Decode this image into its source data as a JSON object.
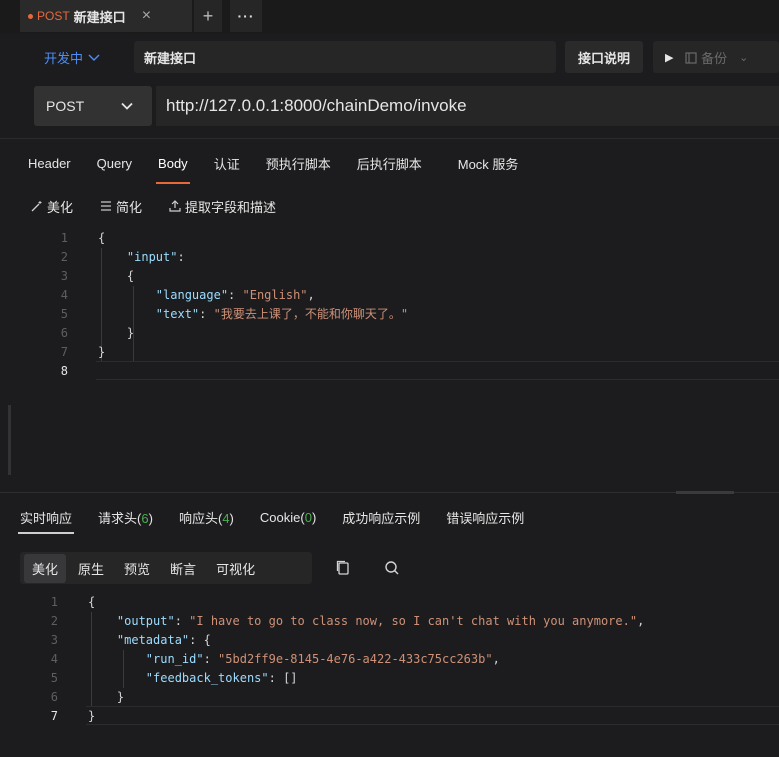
{
  "tab": {
    "method": "POST",
    "title": "新建接口",
    "close": "×",
    "add": "+",
    "more": "···"
  },
  "info": {
    "status": "开发中",
    "name": "新建接口",
    "doc_button": "接口说明",
    "backup_label": "备份"
  },
  "request": {
    "method": "POST",
    "url": "http://127.0.0.1:8000/chainDemo/invoke"
  },
  "req_tabs": [
    "Header",
    "Query",
    "Body",
    "认证",
    "预执行脚本",
    "后执行脚本",
    "Mock 服务"
  ],
  "req_active_tab": "Body",
  "body_tools": {
    "beautify": "美化",
    "simplify": "简化",
    "extract": "提取字段和描述"
  },
  "request_body": {
    "line_numbers": [
      "1",
      "2",
      "3",
      "4",
      "5",
      "6",
      "7",
      "8"
    ],
    "l1": "{",
    "l2_key": "\"input\"",
    "l2_colon": ":",
    "l3": "{",
    "l4_key": "\"language\"",
    "l4_sep": ": ",
    "l4_val": "\"English\"",
    "l4_end": ",",
    "l5_key": "\"text\"",
    "l5_sep": ": ",
    "l5_val": "\"我要去上课了，不能和你聊天了。\"",
    "l6": "}",
    "l7": "}"
  },
  "resp_tabs": {
    "realtime": "实时响应",
    "req_headers": "请求头",
    "req_headers_count": "6",
    "resp_headers": "响应头",
    "resp_headers_count": "4",
    "cookie": "Cookie",
    "cookie_count": "0",
    "success_example": "成功响应示例",
    "error_example": "错误响应示例"
  },
  "resp_tools": [
    "美化",
    "原生",
    "预览",
    "断言",
    "可视化"
  ],
  "resp_active_tool": "美化",
  "response_body": {
    "line_numbers": [
      "1",
      "2",
      "3",
      "4",
      "5",
      "6",
      "7"
    ],
    "l1": "{",
    "l2_key": "\"output\"",
    "l2_sep": ": ",
    "l2_val": "\"I have to go to class now, so I can't chat with you anymore.\"",
    "l2_end": ",",
    "l3_key": "\"metadata\"",
    "l3_sep": ": {",
    "l4_key": "\"run_id\"",
    "l4_sep": ": ",
    "l4_val": "\"5bd2ff9e-8145-4e76-a422-433c75cc263b\"",
    "l4_end": ",",
    "l5_key": "\"feedback_tokens\"",
    "l5_sep": ": []",
    "l6": "}",
    "l7": "}"
  },
  "colors": {
    "accent": "#e8683a",
    "link_blue": "#4c8df6",
    "json_key": "#9cdcfe",
    "json_string": "#ce9178",
    "count_green": "#4caf50"
  },
  "icons": [
    "close-icon",
    "add-icon",
    "more-icon",
    "chevron-down-icon",
    "play-icon",
    "backup-icon",
    "beautify-icon",
    "simplify-icon",
    "extract-icon",
    "copy-icon",
    "search-icon"
  ]
}
